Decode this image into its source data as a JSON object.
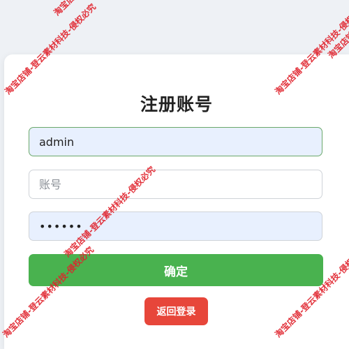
{
  "form": {
    "title": "注册账号",
    "username_value": "admin",
    "account_placeholder": "账号",
    "password_value": "••••••",
    "confirm_label": "确定",
    "back_label": "返回登录"
  },
  "watermark": {
    "text": "淘宝店铺-登云素材科技-侵权必究"
  },
  "colors": {
    "confirm": "#49b24f",
    "back": "#e7463a",
    "watermark": "#e0222c"
  }
}
